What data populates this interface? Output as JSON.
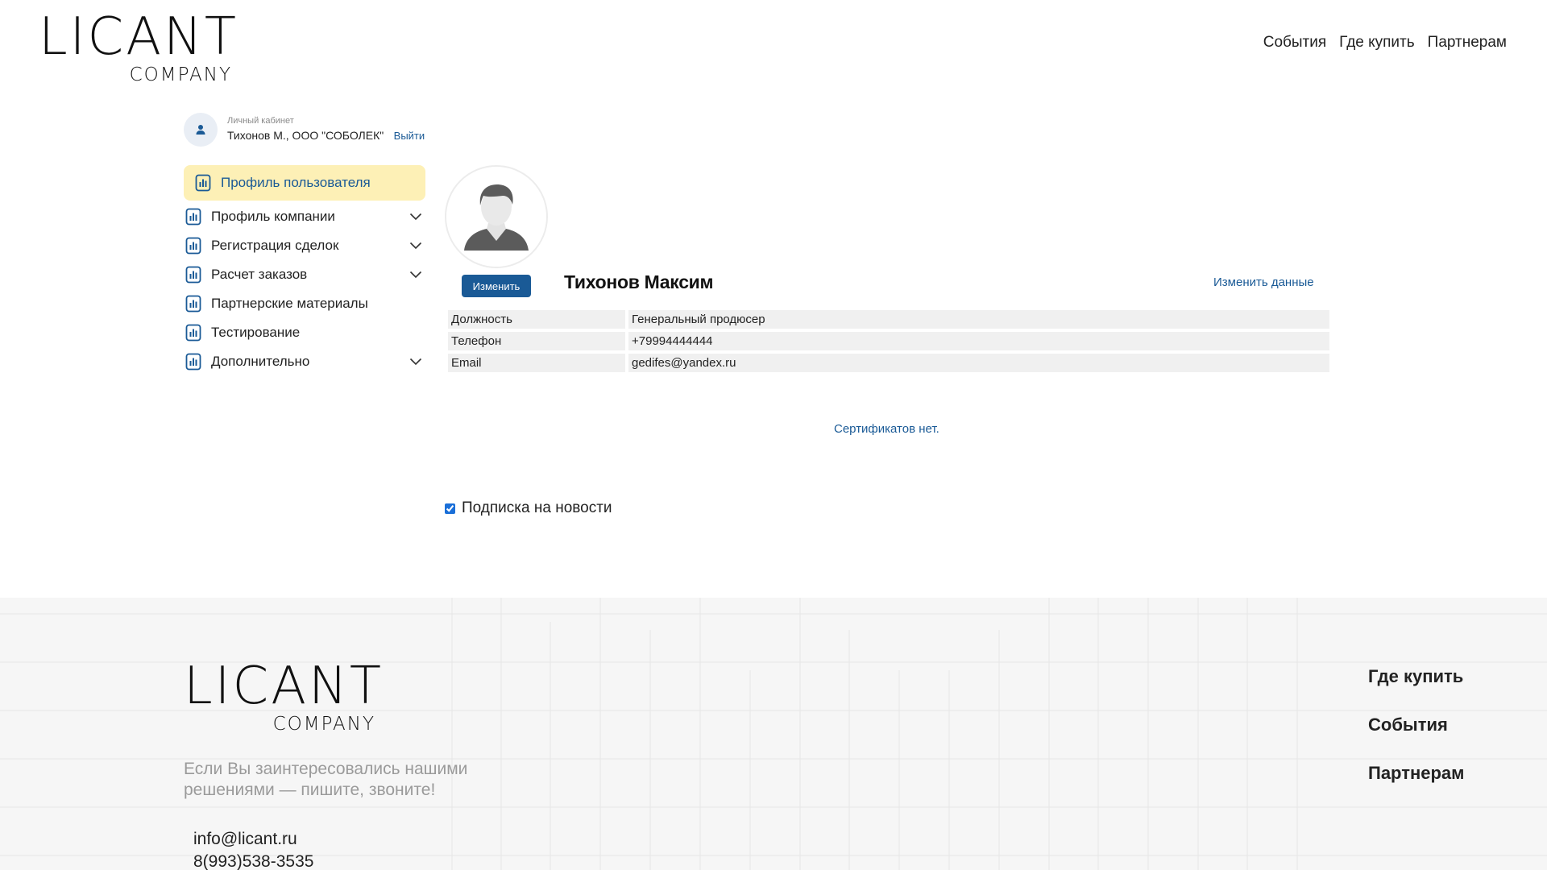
{
  "brand": {
    "logo_main": "LICANT",
    "logo_sub": "COMPANY"
  },
  "top_nav": [
    {
      "label": "События"
    },
    {
      "label": "Где купить"
    },
    {
      "label": "Партнерам"
    }
  ],
  "account": {
    "label": "Личный кабинет",
    "name": "Тихонов М., ООО \"СОБОЛЕК\"",
    "logout": "Выйти"
  },
  "sidebar": {
    "items": [
      {
        "label": "Профиль пользователя",
        "active": true,
        "expandable": false
      },
      {
        "label": "Профиль компании",
        "active": false,
        "expandable": true
      },
      {
        "label": "Регистрация сделок",
        "active": false,
        "expandable": true
      },
      {
        "label": "Расчет заказов",
        "active": false,
        "expandable": true
      },
      {
        "label": "Партнерские материалы",
        "active": false,
        "expandable": false
      },
      {
        "label": "Тестирование",
        "active": false,
        "expandable": false
      },
      {
        "label": "Дополнительно",
        "active": false,
        "expandable": true
      }
    ]
  },
  "profile": {
    "change_photo": "Изменить",
    "full_name": "Тихонов Максим",
    "edit_data": "Изменить данные",
    "fields": [
      {
        "key": "Должность",
        "value": "Генеральный продюсер"
      },
      {
        "key": "Телефон",
        "value": "+79994444444"
      },
      {
        "key": "Email",
        "value": "gedifes@yandex.ru"
      }
    ],
    "certificates": "Сертификатов нет.",
    "subscribe_label": "Подписка на новости",
    "subscribe_checked": true
  },
  "footer": {
    "tagline": "Если Вы заинтересовались нашими решениями — пишите, звоните!",
    "email": "info@licant.ru",
    "phone": "8(993)538-3535",
    "nav": [
      {
        "label": "Где купить"
      },
      {
        "label": "События"
      },
      {
        "label": "Партнерам"
      }
    ]
  },
  "colors": {
    "accent": "#1a5a96",
    "active_bg": "#fdf0b6",
    "field_bg": "#f0f0f0",
    "footer_bg": "#f6f6f6"
  }
}
